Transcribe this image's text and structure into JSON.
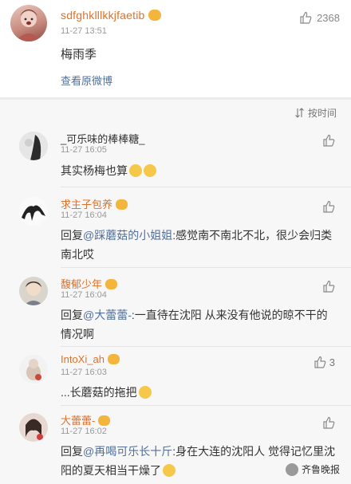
{
  "post": {
    "username": "sdfghklllkkjfaetib",
    "time": "11-27 13:51",
    "content": "梅雨季",
    "view_original": "查看原微博",
    "like_count": "2368"
  },
  "sort_label": "按时间",
  "comments": [
    {
      "username": "_可乐味的棒棒糖_",
      "time": "11-27 16:05",
      "text": "其实杨梅也算"
    },
    {
      "username": "求主子包养",
      "time": "11-27 16:04",
      "reply_prefix": "回复",
      "mention": "@踩蘑菇的小姐姐",
      "text": ":感觉南不南北不北，很少会归类南北哎"
    },
    {
      "username": "馥郁少年",
      "time": "11-27 16:04",
      "reply_prefix": "回复",
      "mention": "@大蕾蕾-",
      "text": ":一直待在沈阳 从来没有他说的晾不干的情况啊"
    },
    {
      "username": "IntoXi_ah",
      "time": "11-27 16:03",
      "text": "...长蘑菇的拖把",
      "like_count": "3"
    },
    {
      "username": "大蕾蕾-",
      "time": "11-27 16:02",
      "reply_prefix": "回复",
      "mention": "@再喝可乐长十斤",
      "text": ":身在大连的沈阳人 觉得记忆里沈阳的夏天相当干燥了"
    }
  ],
  "watermark": "齐鲁晚报",
  "colors": {
    "username_orange": "#e0712b",
    "link_blue": "#52709a",
    "comment_bg": "#f7f7f7"
  }
}
